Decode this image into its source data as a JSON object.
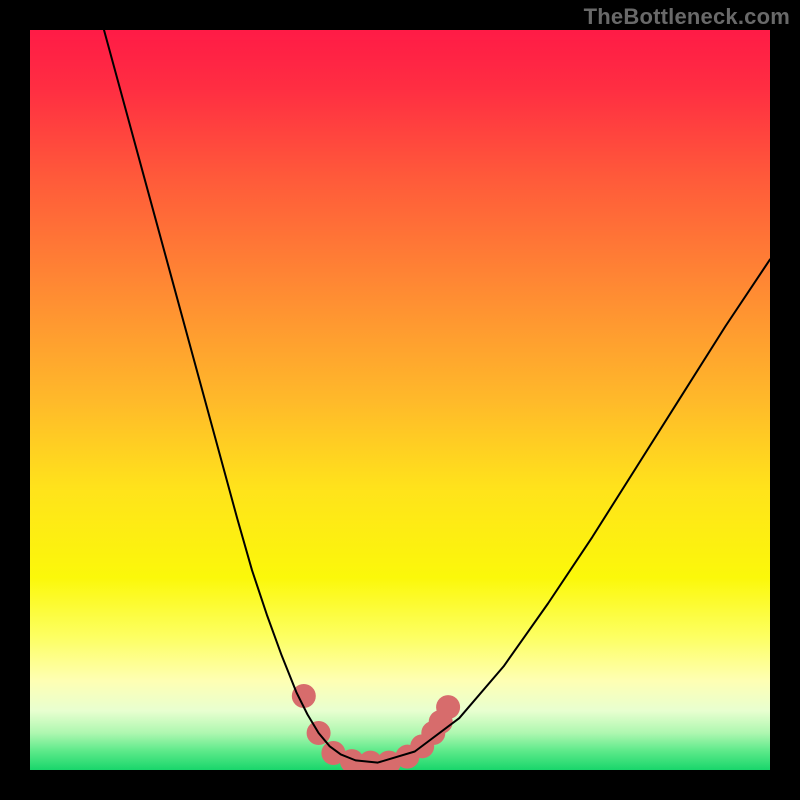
{
  "attribution": "TheBottleneck.com",
  "chart_data": {
    "type": "line",
    "title": "",
    "xlabel": "",
    "ylabel": "",
    "xlim": [
      0,
      100
    ],
    "ylim": [
      0,
      100
    ],
    "background_gradient_stops": [
      {
        "offset": 0.0,
        "color": "#ff1b46"
      },
      {
        "offset": 0.08,
        "color": "#ff2e42"
      },
      {
        "offset": 0.2,
        "color": "#ff5a3a"
      },
      {
        "offset": 0.35,
        "color": "#ff8a33"
      },
      {
        "offset": 0.5,
        "color": "#ffb92a"
      },
      {
        "offset": 0.62,
        "color": "#ffe31b"
      },
      {
        "offset": 0.74,
        "color": "#fbf80a"
      },
      {
        "offset": 0.82,
        "color": "#fdff62"
      },
      {
        "offset": 0.88,
        "color": "#feffb4"
      },
      {
        "offset": 0.92,
        "color": "#e8ffd0"
      },
      {
        "offset": 0.95,
        "color": "#aef7b0"
      },
      {
        "offset": 0.975,
        "color": "#5be989"
      },
      {
        "offset": 1.0,
        "color": "#19d66b"
      }
    ],
    "series": [
      {
        "name": "bottleneck-curve",
        "color": "#000000",
        "stroke_width": 2,
        "x": [
          10,
          13,
          16,
          19,
          22,
          25,
          28,
          30,
          32,
          34,
          36,
          37.5,
          39,
          40.5,
          42,
          44,
          47,
          52,
          58,
          64,
          70,
          76,
          82,
          88,
          94,
          100
        ],
        "values": [
          100,
          89,
          78,
          67,
          56,
          45,
          34,
          27,
          21,
          15.5,
          10.5,
          7.5,
          5,
          3.2,
          2.1,
          1.3,
          1.0,
          2.5,
          7,
          14,
          22.5,
          31.5,
          41,
          50.5,
          60,
          69
        ]
      }
    ],
    "markers": {
      "name": "bottom-cluster",
      "color": "#d76c6c",
      "radius": 12,
      "points": [
        {
          "x": 37.0,
          "y": 10.0
        },
        {
          "x": 39.0,
          "y": 5.0
        },
        {
          "x": 41.0,
          "y": 2.3
        },
        {
          "x": 43.5,
          "y": 1.2
        },
        {
          "x": 46.0,
          "y": 1.0
        },
        {
          "x": 48.5,
          "y": 1.0
        },
        {
          "x": 51.0,
          "y": 1.8
        },
        {
          "x": 53.0,
          "y": 3.2
        },
        {
          "x": 54.5,
          "y": 5.0
        },
        {
          "x": 55.5,
          "y": 6.5
        },
        {
          "x": 56.5,
          "y": 8.5
        }
      ]
    }
  }
}
